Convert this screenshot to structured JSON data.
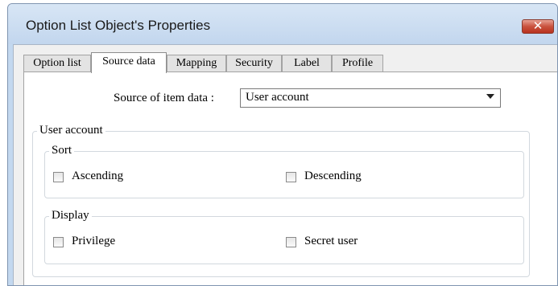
{
  "window": {
    "title": "Option List Object's Properties",
    "close_symbol": "✕"
  },
  "tabs": [
    {
      "label": "Option list",
      "active": false
    },
    {
      "label": "Source data",
      "active": true
    },
    {
      "label": "Mapping",
      "active": false
    },
    {
      "label": "Security",
      "active": false
    },
    {
      "label": "Label",
      "active": false
    },
    {
      "label": "Profile",
      "active": false
    }
  ],
  "source": {
    "label": "Source of item data :",
    "selected": "User account"
  },
  "user_account_group": {
    "legend": "User account",
    "sort": {
      "legend": "Sort",
      "ascending_label": "Ascending",
      "ascending_checked": false,
      "descending_label": "Descending",
      "descending_checked": false
    },
    "display": {
      "legend": "Display",
      "privilege_label": "Privilege",
      "privilege_checked": false,
      "secret_user_label": "Secret user",
      "secret_user_checked": false
    }
  }
}
